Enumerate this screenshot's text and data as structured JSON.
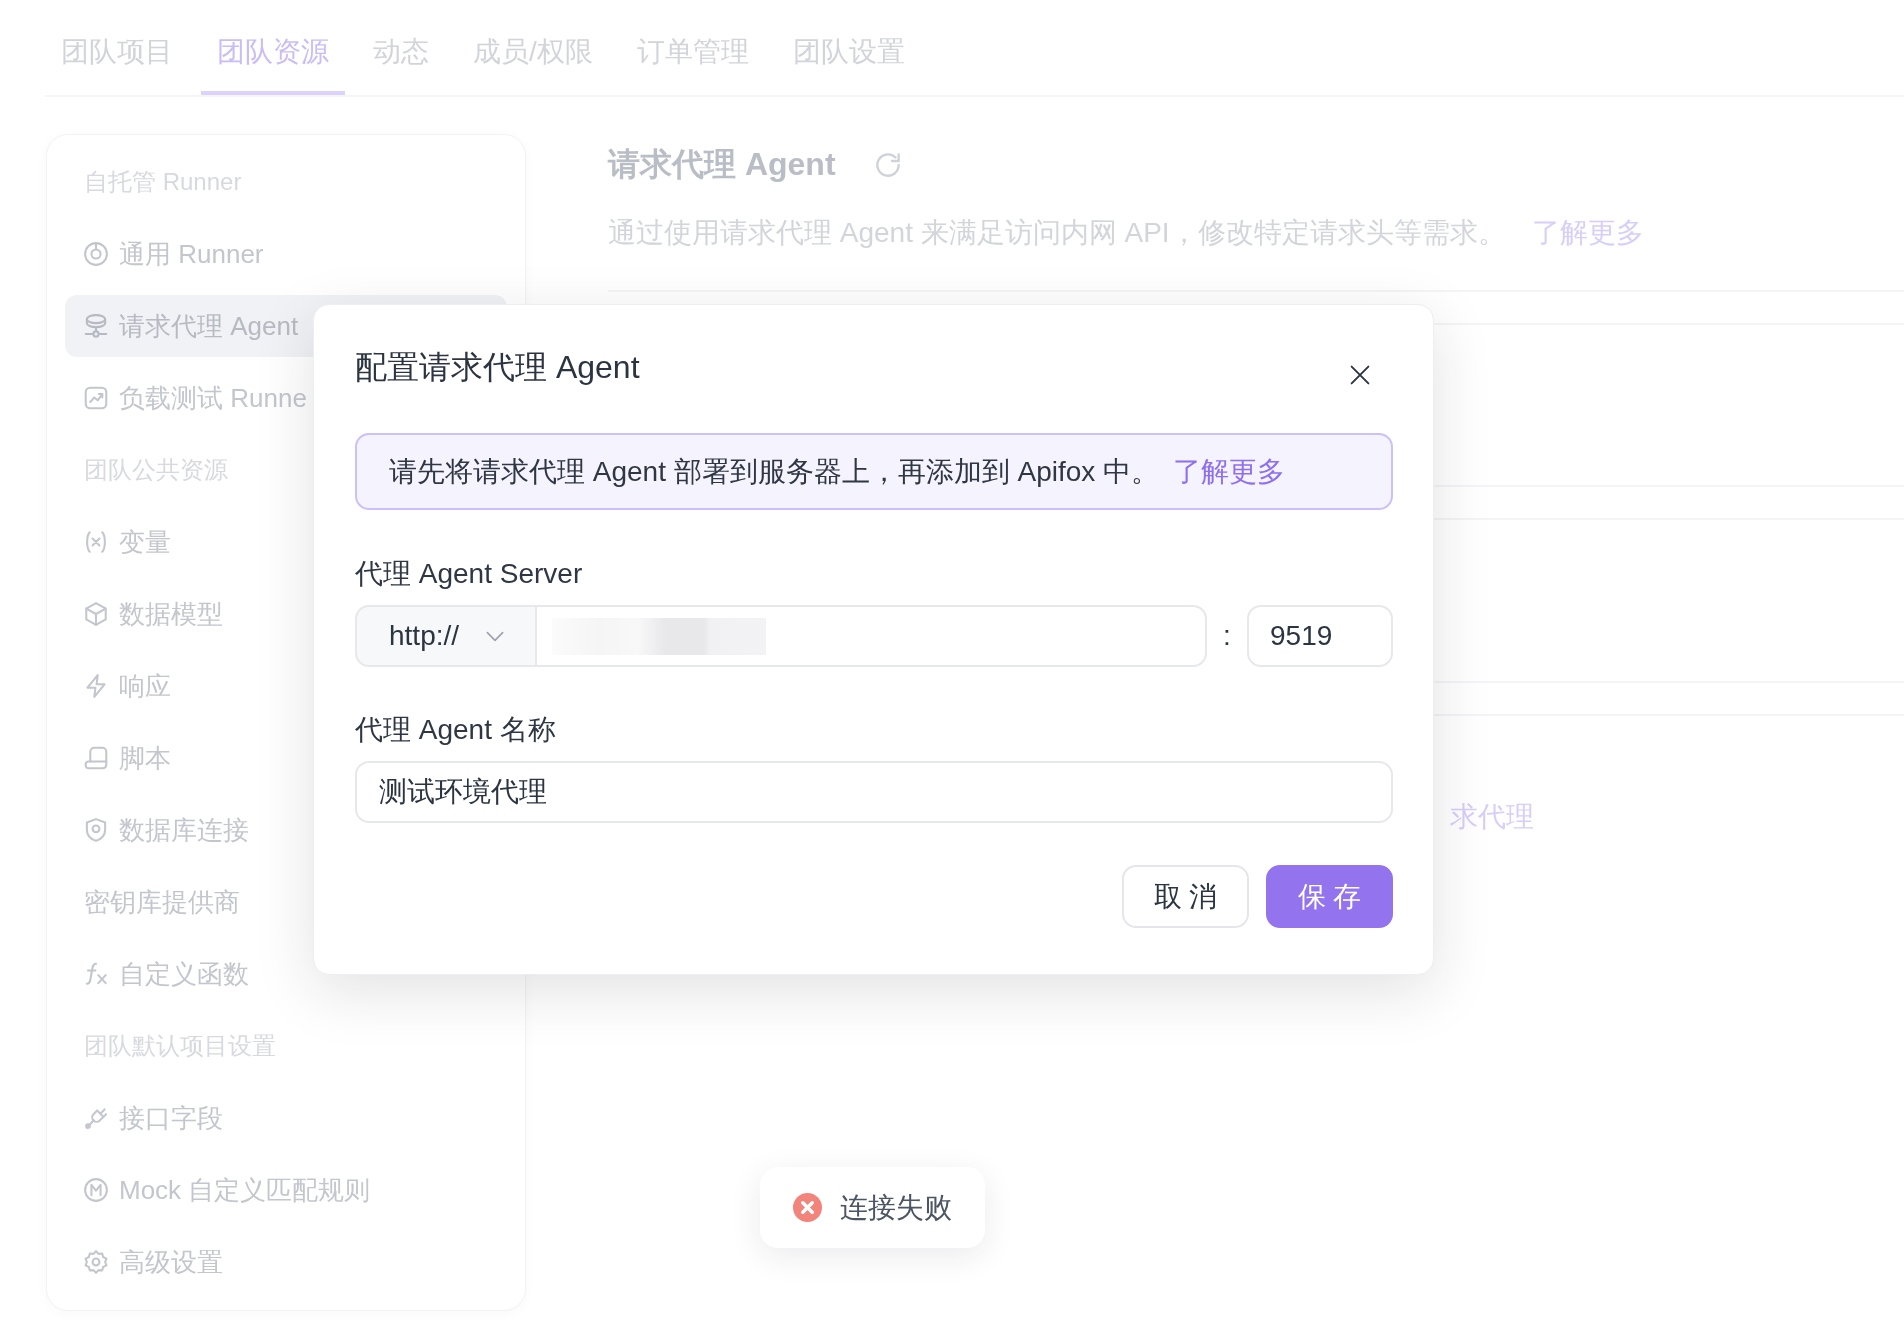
{
  "tabs": [
    {
      "label": "团队项目",
      "selected": false
    },
    {
      "label": "团队资源",
      "selected": true
    },
    {
      "label": "动态",
      "selected": false
    },
    {
      "label": "成员/权限",
      "selected": false
    },
    {
      "label": "订单管理",
      "selected": false
    },
    {
      "label": "团队设置",
      "selected": false
    }
  ],
  "sidebar": {
    "items": [
      {
        "kind": "header",
        "label": "自托管 Runner"
      },
      {
        "kind": "item",
        "label": "通用 Runner",
        "selected": false
      },
      {
        "kind": "item",
        "label": "请求代理 Agent",
        "selected": true
      },
      {
        "kind": "item",
        "label": "负载测试 Runne",
        "selected": false
      },
      {
        "kind": "header",
        "label": "团队公共资源"
      },
      {
        "kind": "item",
        "label": "变量",
        "selected": false
      },
      {
        "kind": "item",
        "label": "数据模型",
        "selected": false
      },
      {
        "kind": "item",
        "label": "响应",
        "selected": false
      },
      {
        "kind": "item",
        "label": "脚本",
        "selected": false
      },
      {
        "kind": "item",
        "label": "数据库连接",
        "selected": false
      },
      {
        "kind": "item",
        "label": "密钥库提供商",
        "selected": false
      },
      {
        "kind": "item",
        "label": "自定义函数",
        "selected": false
      },
      {
        "kind": "header",
        "label": "团队默认项目设置"
      },
      {
        "kind": "item",
        "label": "接口字段",
        "selected": false
      },
      {
        "kind": "item",
        "label": "Mock 自定义匹配规则",
        "selected": false
      },
      {
        "kind": "item",
        "label": "高级设置",
        "selected": false
      }
    ]
  },
  "panel": {
    "title": "请求代理 Agent",
    "description": "通过使用请求代理 Agent 来满足访问内网 API，修改特定请求头等需求。",
    "link": "了解更多",
    "partial_link": "求代理"
  },
  "dialog": {
    "title": "配置请求代理 Agent",
    "notice": {
      "text": "请先将请求代理 Agent 部署到服务器上，再添加到 Apifox 中。",
      "link": "了解更多"
    },
    "server": {
      "label": "代理 Agent Server",
      "protocol": "http://",
      "host_redacted": true,
      "separator": ":",
      "port": "9519"
    },
    "agent_name": {
      "label": "代理 Agent 名称",
      "value": "测试环境代理"
    },
    "buttons": [
      {
        "label": "取 消",
        "kind": "secondary"
      },
      {
        "label": "保 存",
        "kind": "primary"
      }
    ]
  },
  "toast": {
    "kind": "error",
    "message": "连接失败"
  }
}
